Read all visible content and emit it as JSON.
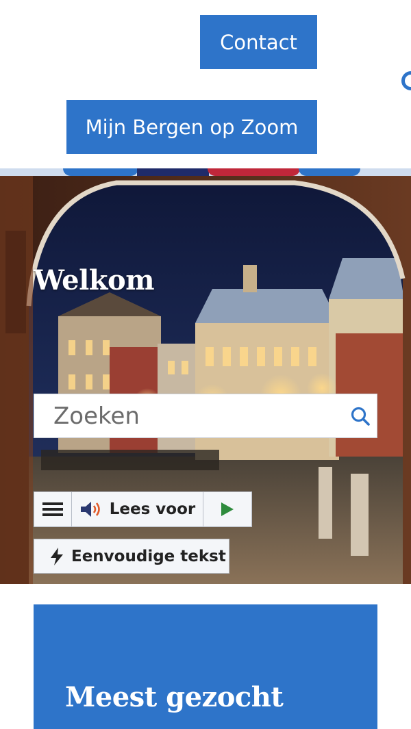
{
  "header": {
    "contact_label": "Contact",
    "mijn_label": "Mijn Bergen op Zoom"
  },
  "hero": {
    "title": "Welkom"
  },
  "search": {
    "placeholder": "Zoeken",
    "icon": "search-icon"
  },
  "readspeaker": {
    "menu_icon": "hamburger-menu-icon",
    "listen_icon": "speaker-icon",
    "listen_label": "Lees voor",
    "play_icon": "play-icon"
  },
  "simple_text": {
    "icon": "lightning-icon",
    "label": "Eenvoudige tekst"
  },
  "most_searched": {
    "title": "Meest gezocht"
  },
  "colors": {
    "brand_blue": "#2e74c9",
    "accent_red": "#c0273a",
    "accent_navy": "#1f2b6a",
    "play_green": "#2e8b3d"
  }
}
